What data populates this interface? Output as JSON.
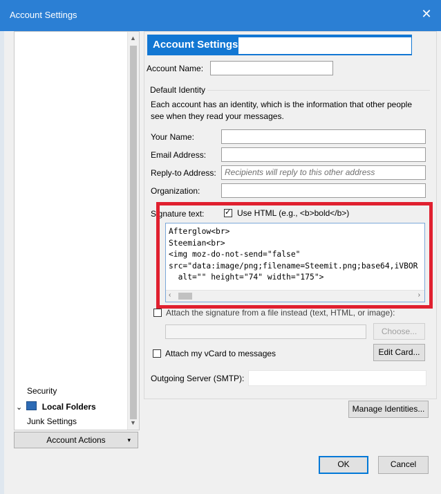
{
  "window": {
    "title": "Account Settings",
    "close_glyph": "✕"
  },
  "tree": {
    "items": [
      {
        "label": "Security"
      },
      {
        "label": "Local Folders"
      },
      {
        "label": "Junk Settings"
      }
    ],
    "local_folders_icon": "computer-icon",
    "expand_glyph": "⌄"
  },
  "account_actions": {
    "label": "Account Actions",
    "arrow": "▾"
  },
  "banner": {
    "title": "Account Settings -"
  },
  "account_name": {
    "label": "Account Name:",
    "value": ""
  },
  "default_identity": {
    "heading": "Default Identity",
    "description": "Each account has an identity, which is the information that other people see when they read your messages.",
    "your_name": {
      "label": "Your Name:",
      "value": ""
    },
    "email": {
      "label": "Email Address:",
      "value": ""
    },
    "reply_to": {
      "label": "Reply-to Address:",
      "placeholder": "Recipients will reply to this other address"
    },
    "organization": {
      "label": "Organization:",
      "value": ""
    },
    "signature": {
      "label": "Signature text:",
      "use_html_label": "Use HTML (e.g., <b>bold</b>)",
      "use_html_checked": true,
      "text": "Afterglow<br>\nSteemian<br>\n<img moz-do-not-send=\"false\"\nsrc=\"data:image/png;filename=Steemit.png;base64,iVBOR\n  alt=\"\" height=\"74\" width=\"175\">"
    },
    "attach_file_label": "Attach the signature from a file instead (text, HTML, or image):",
    "choose_button": "Choose...",
    "attach_vcard_label": "Attach my vCard to messages",
    "edit_card_button": "Edit Card...",
    "outgoing_label": "Outgoing Server (SMTP):",
    "outgoing_value": "",
    "manage_identities_button": "Manage Identities..."
  },
  "footer": {
    "ok": "OK",
    "cancel": "Cancel"
  },
  "colors": {
    "title_bar": "#2b7fd4",
    "banner": "#1277d3",
    "highlight": "#e0202f"
  }
}
